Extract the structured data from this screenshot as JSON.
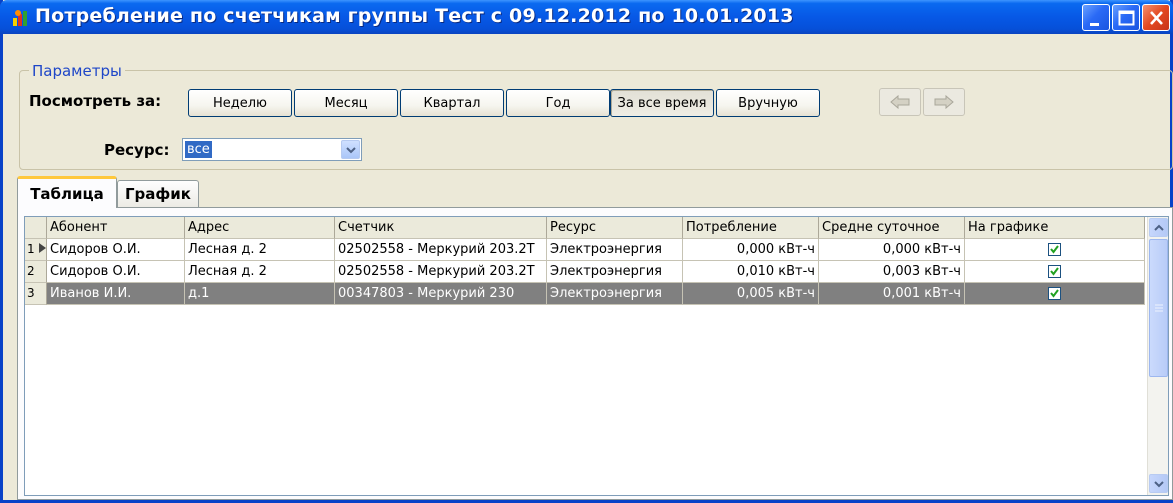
{
  "window": {
    "title": "Потребление по счетчикам группы Тест с 09.12.2012 по 10.01.2013"
  },
  "params": {
    "legend": "Параметры",
    "period_label": "Посмотреть за:",
    "period_buttons": [
      "Неделю",
      "Месяц",
      "Квартал",
      "Год",
      "За все время",
      "Вручную"
    ],
    "pressed_button": "За все время",
    "resource_label": "Ресурс:",
    "resource_value": "все"
  },
  "tabs": [
    {
      "label": "Таблица",
      "active": true
    },
    {
      "label": "График",
      "active": false
    }
  ],
  "grid": {
    "columns": [
      "Абонент",
      "Адрес",
      "Счетчик",
      "Ресурс",
      "Потребление",
      "Средне суточное",
      "На графике"
    ],
    "rows": [
      {
        "num": "1",
        "abonent": "Сидоров О.И.",
        "address": "Лесная д. 2",
        "meter": "02502558 - Меркурий 203.2T",
        "resource": "Электроэнергия",
        "consumption": "0,000 кВт-ч",
        "daily": "0,000 кВт-ч",
        "on_chart": true,
        "current": true,
        "selected": false
      },
      {
        "num": "2",
        "abonent": "Сидоров О.И.",
        "address": "Лесная д. 2",
        "meter": "02502558 - Меркурий 203.2T",
        "resource": "Электроэнергия",
        "consumption": "0,010 кВт-ч",
        "daily": "0,003 кВт-ч",
        "on_chart": true,
        "current": false,
        "selected": false
      },
      {
        "num": "3",
        "abonent": "Иванов И.И.",
        "address": "д.1",
        "meter": "00347803 - Меркурий 230",
        "resource": "Электроэнергия",
        "consumption": "0,005 кВт-ч",
        "daily": "0,001 кВт-ч",
        "on_chart": true,
        "current": false,
        "selected": true
      }
    ]
  },
  "colors": {
    "titlebar": "#0758e6",
    "selected_row": "#808080",
    "tab_highlight": "#ffc83c",
    "legend_text": "#1e46c8"
  },
  "icons": {
    "app": "app-multicolor-icon",
    "minimize": "minimize-icon",
    "maximize": "maximize-icon",
    "close": "close-icon",
    "back": "arrow-left-icon",
    "forward": "arrow-right-icon",
    "dropdown": "chevron-down-icon",
    "row_pointer": "row-pointer-icon",
    "check": "checkmark-icon"
  }
}
